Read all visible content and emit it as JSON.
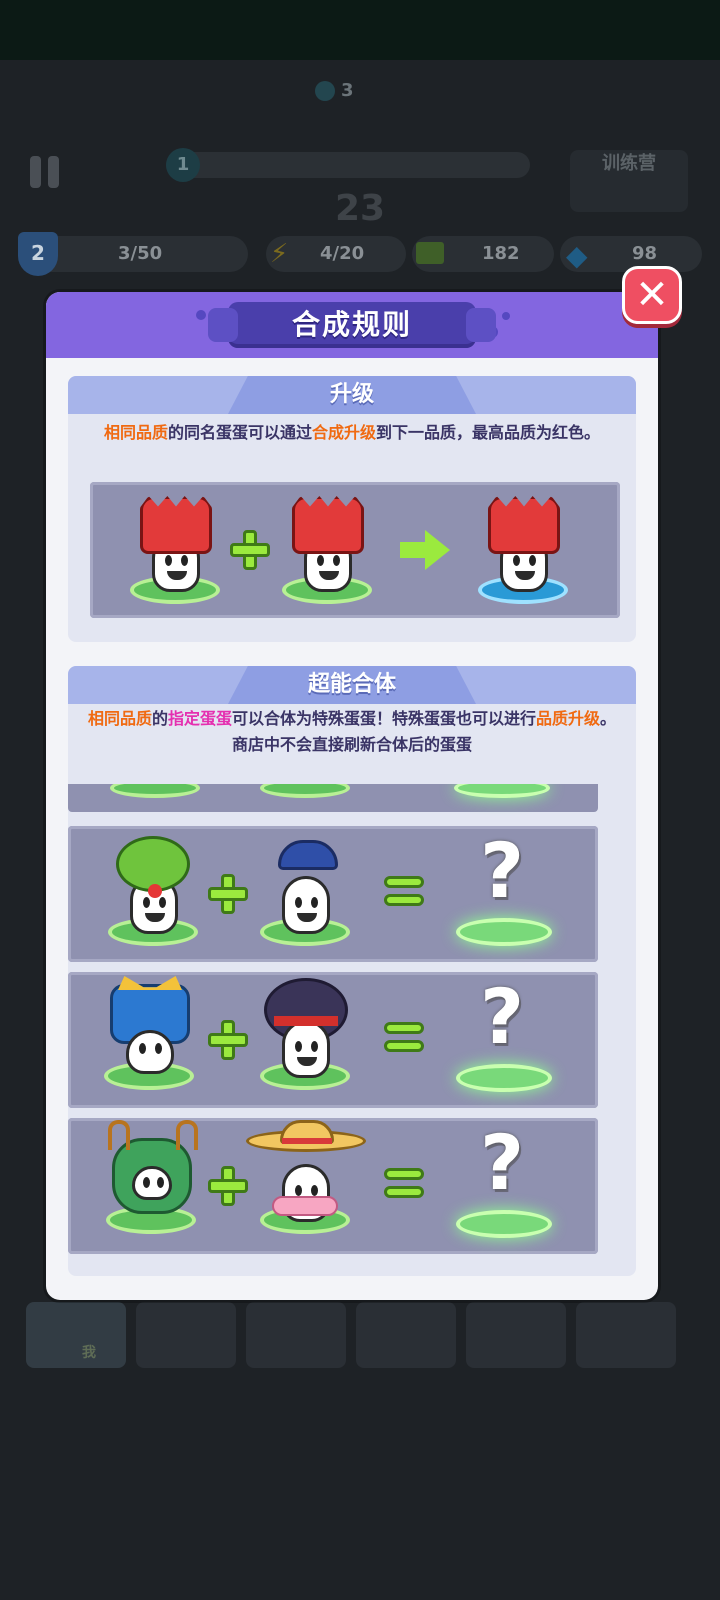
{
  "background_hud": {
    "wave_count": "3",
    "counter": "23",
    "training_label": "训练营",
    "level_badge": "2",
    "level_progress": "3/50",
    "energy": "4/20",
    "cash": "182",
    "gems": "98",
    "slot_label": "我"
  },
  "modal": {
    "title": "合成规则",
    "close_icon": "close-x-icon",
    "upgrade_section": {
      "title": "升级",
      "desc_parts": [
        "相同品质",
        "的同名蛋蛋可以通过",
        "合成升级",
        "到下一品质，最高品质为红色。"
      ],
      "example": {
        "left": "red-hair-egg",
        "op1": "plus-icon",
        "middle": "red-hair-egg",
        "op2": "arrow-right-icon",
        "result": "red-hair-egg-upgraded"
      }
    },
    "fusion_section": {
      "title": "超能合体",
      "desc_line1_parts": [
        "相同品质",
        "的",
        "指定蛋蛋",
        "可以合体为特殊蛋蛋！特殊蛋蛋也可以进行",
        "品质升级",
        "。"
      ],
      "desc_line2": "商店中不会直接刷新合体后的蛋蛋",
      "combos": [
        {
          "left": "clown-egg",
          "right": "police-egg",
          "result": "?"
        },
        {
          "left": "mecha-egg",
          "right": "rambo-egg",
          "result": "?"
        },
        {
          "left": "forest-spirit-egg",
          "right": "straw-hat-egg",
          "result": "?"
        }
      ]
    }
  },
  "colors": {
    "header_purple": "#8366e0",
    "highlight_orange": "#f06a12",
    "highlight_pink": "#e52fb0",
    "close_red": "#ef4f62"
  }
}
